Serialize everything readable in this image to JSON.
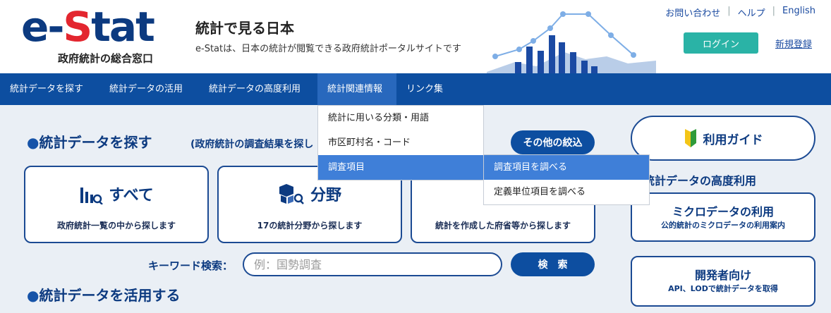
{
  "header": {
    "logo_text_a": "e-",
    "logo_text_s": "S",
    "logo_text_b": "tat",
    "logo_subtitle": "政府統計の総合窓口",
    "site_title": "統計で見る日本",
    "site_description": "e-Statは、日本の統計が閲覧できる政府統計ポータルサイトです",
    "top_links": [
      "お問い合わせ",
      "ヘルプ",
      "English"
    ],
    "top_link_separator": "|",
    "login_label": "ログイン",
    "register_label": "新規登録"
  },
  "nav": {
    "items": [
      {
        "label": "統計データを探す"
      },
      {
        "label": "統計データの活用"
      },
      {
        "label": "統計データの高度利用"
      },
      {
        "label": "統計関連情報"
      },
      {
        "label": "リンク集"
      }
    ]
  },
  "dropdown": {
    "items": [
      "統計に用いる分類・用語",
      "市区町村名・コード",
      "調査項目"
    ],
    "submenu": [
      "調査項目を調べる",
      "定義単位項目を調べる"
    ]
  },
  "search_section": {
    "title": "統計データを探す",
    "subtitle": "(政府統計の調査結果を探し",
    "filter_button": "その他の絞込",
    "cards": [
      {
        "title": "すべて",
        "description": "政府統計一覧の中から探します"
      },
      {
        "title": "分野",
        "description": "17の統計分野から探します"
      },
      {
        "title": "",
        "description": "統計を作成した府省等から探します"
      }
    ],
    "keyword_label": "キーワード検索：",
    "keyword_placeholder": "例：国勢調査",
    "search_button": "検　索"
  },
  "use_section": {
    "title": "統計データを活用する"
  },
  "right_panel": {
    "guide_label": "利用ガイド",
    "advanced_heading": "統計データの高度利用",
    "micro_title": "ミクロデータの利用",
    "micro_sub": "公的統計のミクロデータの利用案内",
    "dev_title": "開発者向け",
    "dev_sub": "API、LODで統計データを取得"
  },
  "colors": {
    "nav_bg": "#0d4ea0",
    "accent_teal": "#2ab3a6",
    "logo_red": "#e3262f",
    "highlight": "#3f7fd8"
  }
}
